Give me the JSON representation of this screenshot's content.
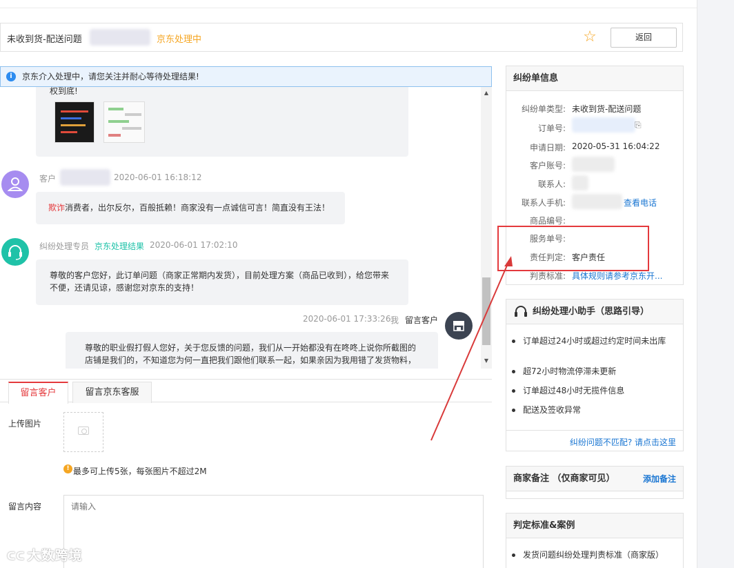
{
  "header": {
    "title": "未收到货-配送问题",
    "status": "京东处理中",
    "back_label": "返回"
  },
  "notice": {
    "text": "京东介入处理中，请您关注并耐心等待处理结果!"
  },
  "chat": {
    "partial_first": "权到底!",
    "messages": [
      {
        "role": "客户",
        "time": "2020-06-01 16:18:12",
        "highlight": "欺诈",
        "text": "消费者，出尔反尔，百般抵赖！商家没有一点诚信可言！简直没有王法！"
      },
      {
        "role": "纠纷处理专员",
        "tag": "京东处理结果",
        "time": "2020-06-01 17:02:10",
        "text": "尊敬的客户您好，此订单问题（商家正常期内发货），目前处理方案（商品已收到），给您带来不便，还请见谅，感谢您对京东的支持！"
      },
      {
        "time": "2020-06-01 17:33:26",
        "me": "我",
        "target": "留言客户",
        "text": "尊敬的职业假打假人您好，关于您反馈的问题，我们从一开始都没有在咚咚上说你所截图的店铺是我们的，不知道您为何一直把我们跟他们联系一起，如果亲因为我用错了发货物料，导致"
      }
    ]
  },
  "reply": {
    "tabs": [
      "留言客户",
      "留言京东客服"
    ],
    "upload_label": "上传图片",
    "upload_hint": "最多可上传5张，每张图片不超过2M",
    "content_label": "留言内容",
    "content_placeholder": "请输入"
  },
  "dispute_info": {
    "title": "纠纷单信息",
    "rows": [
      {
        "label": "纠纷单类型:",
        "value": "未收到货-配送问题"
      },
      {
        "label": "订单号:",
        "value": ""
      },
      {
        "label": "申请日期:",
        "value": "2020-05-31 16:04:22"
      },
      {
        "label": "客户账号:",
        "value": ""
      },
      {
        "label": "联系人:",
        "value": ""
      },
      {
        "label": "联系人手机:",
        "value": "查看电话"
      },
      {
        "label": "商品编号:",
        "value": ""
      },
      {
        "label": "服务单号:",
        "value": ""
      },
      {
        "label": "责任判定:",
        "value": "客户责任"
      },
      {
        "label": "判责标准:",
        "value": "具体规则请参考京东开..."
      }
    ]
  },
  "assistant": {
    "title": "纠纷处理小助手（思路引导）",
    "items": [
      "订单超过24小时或超过约定时间未出库",
      "超72小时物流停滞未更新",
      "订单超过48小时无揽件信息",
      "配送及签收异常"
    ],
    "footer_link": "纠纷问题不匹配? 请点击这里"
  },
  "merchant_note": {
    "title": "商家备注 （仅商家可见）",
    "add_link": "添加备注"
  },
  "standards": {
    "title": "判定标准&案例",
    "items": [
      "发货问题纠纷处理判责标准（商家版）"
    ]
  },
  "watermark": "大数跨境",
  "colors": {
    "accent_red": "#e4393c",
    "status_orange": "#f5a623",
    "link_blue": "#1a76d2",
    "service_teal": "#1fc2a8",
    "customer_purple": "#a68cf0"
  }
}
